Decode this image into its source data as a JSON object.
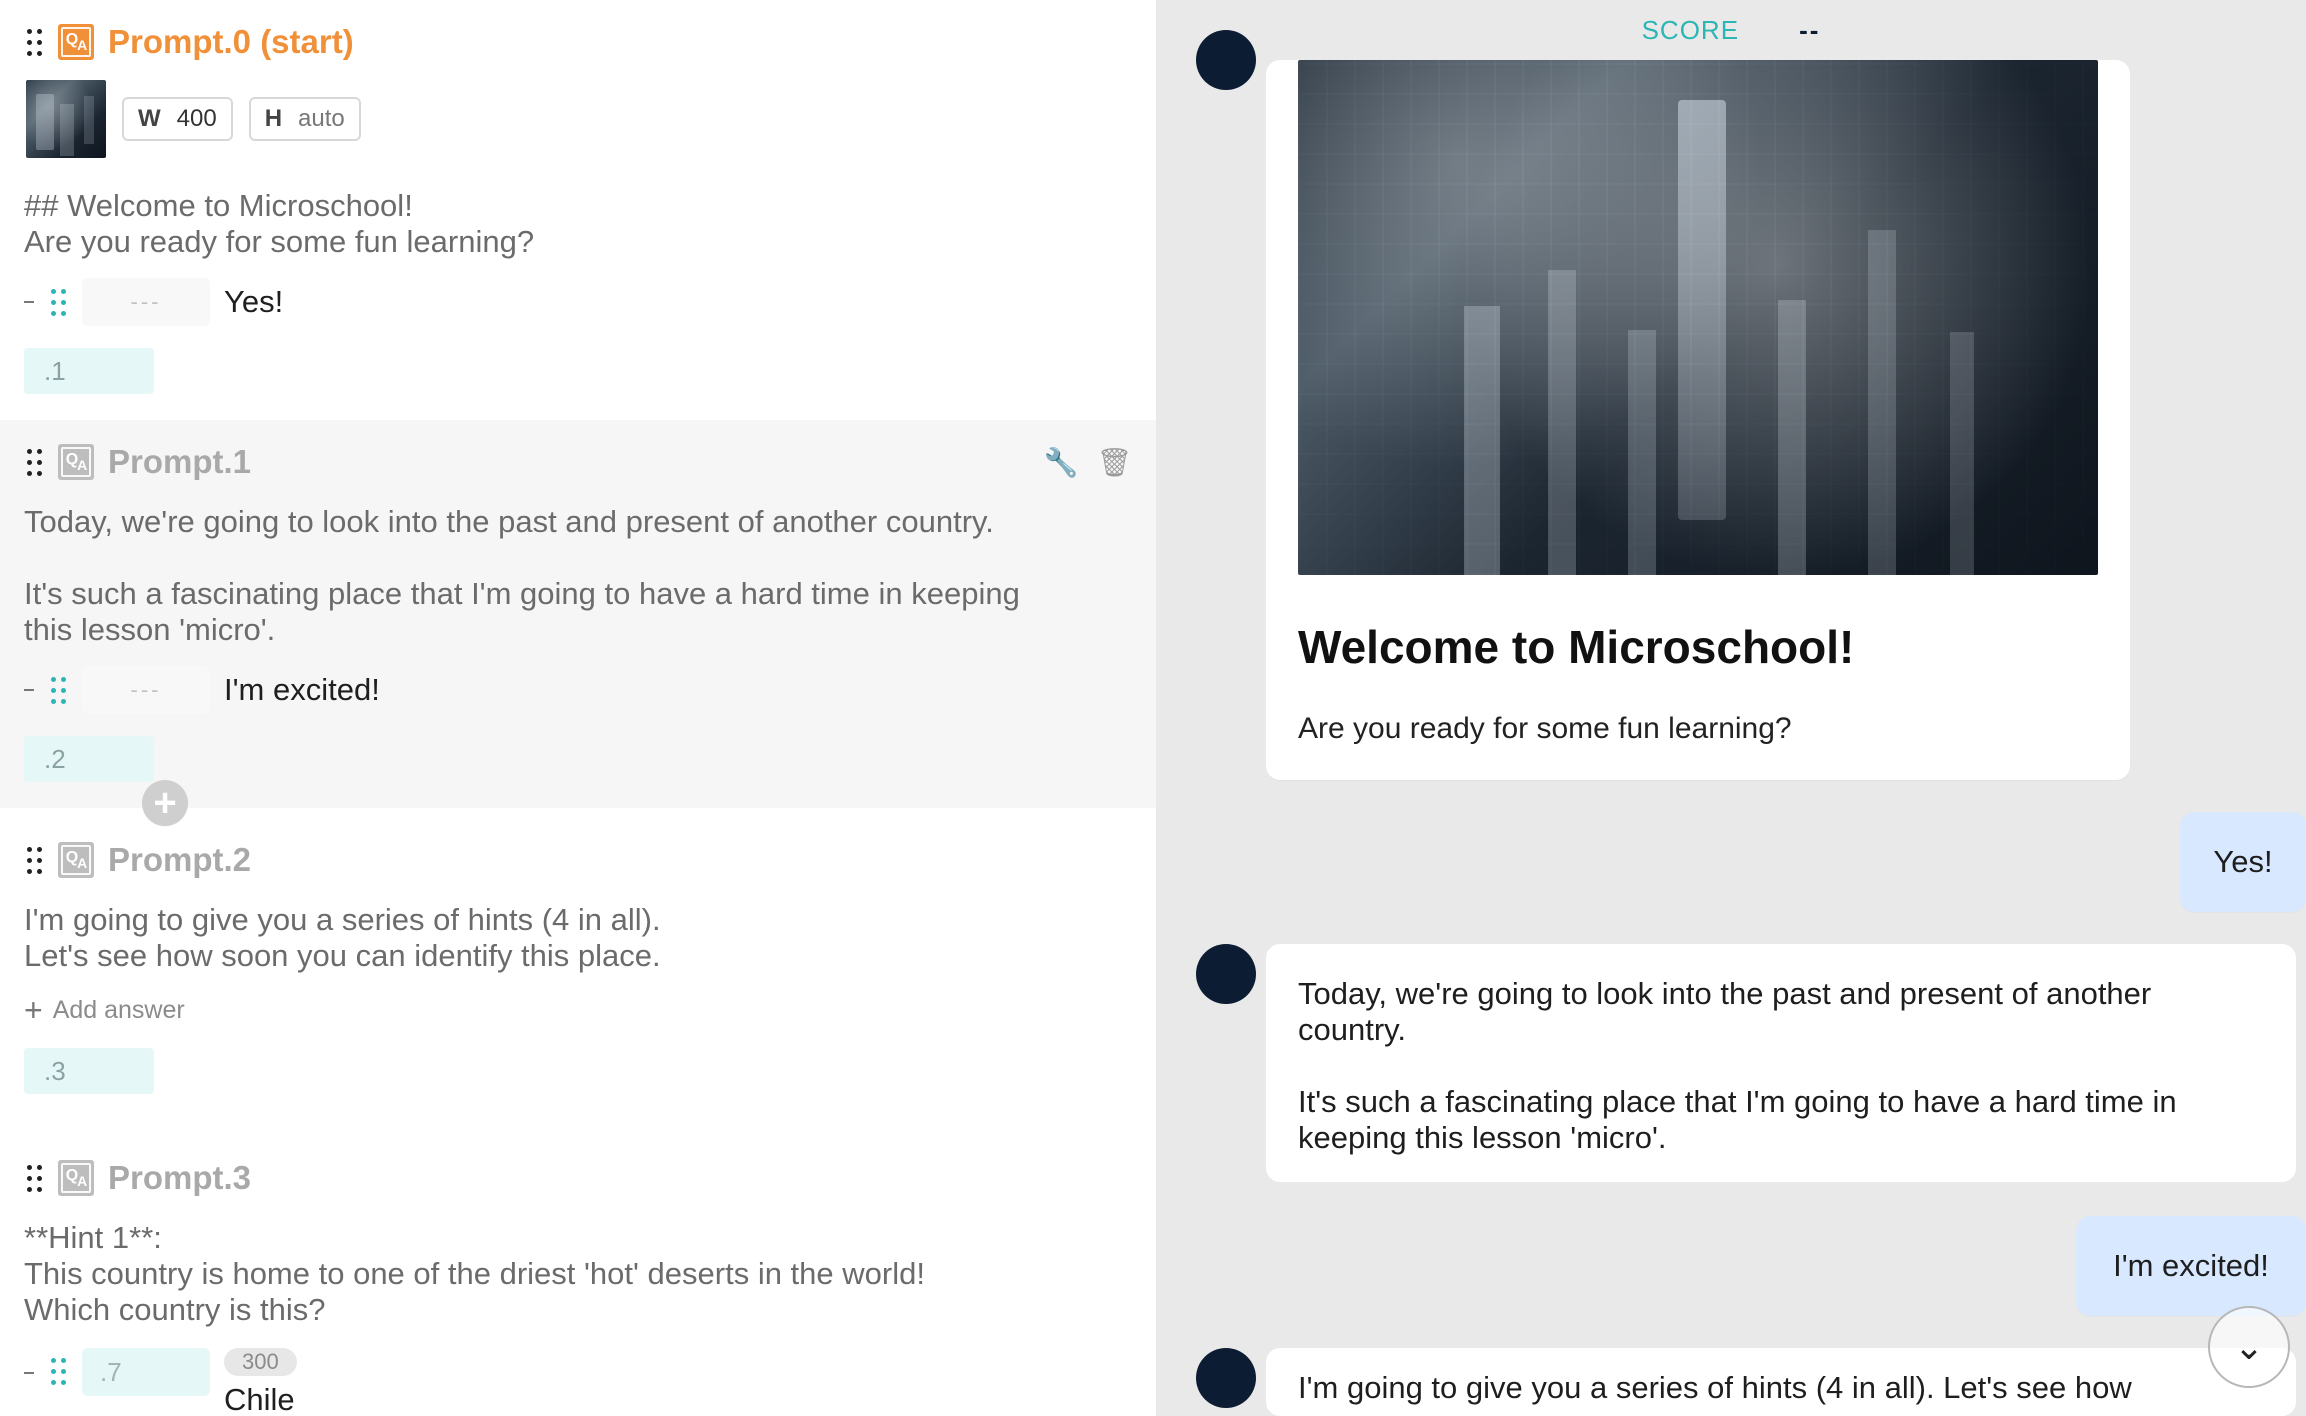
{
  "editor": {
    "prompts": [
      {
        "id": "Prompt.0 (start)",
        "media": {
          "width_label": "W",
          "width_value": "400",
          "height_label": "H",
          "height_value": "auto"
        },
        "text": "## Welcome to Microschool!\nAre you ready for some fun learning?",
        "answers": [
          {
            "key": "---",
            "label": "Yes!"
          }
        ],
        "next": ".1"
      },
      {
        "id": "Prompt.1",
        "text": "Today, we're going to look into the past and present of another country.\n\nIt's such a fascinating place that I'm going to have a hard time in keeping\nthis lesson 'micro'.",
        "answers": [
          {
            "key": "---",
            "label": "I'm excited!"
          }
        ],
        "next": ".2"
      },
      {
        "id": "Prompt.2",
        "text": "I'm going to give you a series of hints (4 in all).\nLet's see how soon you can identify this place.",
        "add_answer": "Add answer",
        "next": ".3"
      },
      {
        "id": "Prompt.3",
        "text": "**Hint 1**:\nThis country is home to one of the driest 'hot' deserts in the world!\nWhich country is this?",
        "answers": [
          {
            "key": ".7",
            "score": "300",
            "label": "Chile"
          }
        ]
      }
    ]
  },
  "chat": {
    "score_label": "SCORE",
    "score_value": "--",
    "welcome_title": "Welcome to Microschool!",
    "welcome_sub": "Are you ready for some fun learning?",
    "user_1": "Yes!",
    "bot_1": "Today, we're going to look into the past and present of another country.\n\nIt's such a fascinating place that I'm going to have a hard time in keeping this lesson 'micro'.",
    "user_2": "I'm excited!",
    "bot_2_partial": "I'm going to give you a series of hints (4 in all). Let's see how"
  },
  "icons": {
    "drag": "drag-handle-icon",
    "qa": "qa-icon",
    "wrench": "wrench-icon",
    "trash": "trash-icon",
    "plus": "plus-icon",
    "chevron": "chevron-down-icon"
  }
}
